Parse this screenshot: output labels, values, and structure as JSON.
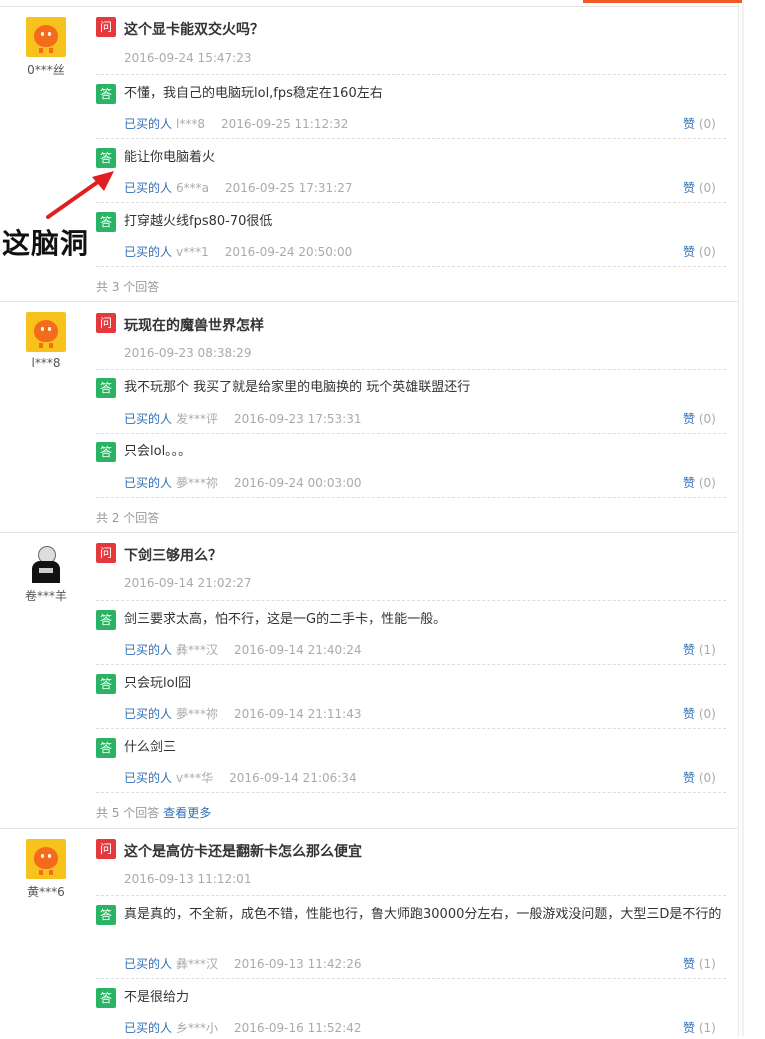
{
  "annotation": {
    "text": "这脑洞"
  },
  "questions": [
    {
      "asker": "0***丝",
      "avatar": "orange-mascot",
      "badge_q": "问",
      "title": "这个显卡能双交火吗？",
      "time": "2016-09-24 15:47:23",
      "answers": [
        {
          "badge": "答",
          "text": "不懂，我自己的电脑玩lol,fps稳定在160左右",
          "buyer": "已买的人",
          "user": "l***8",
          "time": "2016-09-25 11:12:32",
          "like_label": "赞",
          "like_count": "(0)"
        },
        {
          "badge": "答",
          "text": "能让你电脑着火",
          "buyer": "已买的人",
          "user": "6***a",
          "time": "2016-09-25 17:31:27",
          "like_label": "赞",
          "like_count": "(0)"
        },
        {
          "badge": "答",
          "text": "打穿越火线fps80-70很低",
          "buyer": "已买的人",
          "user": "v***1",
          "time": "2016-09-24 20:50:00",
          "like_label": "赞",
          "like_count": "(0)"
        }
      ],
      "count": "共 3 个回答"
    },
    {
      "asker": "l***8",
      "avatar": "orange-mascot",
      "badge_q": "问",
      "title": "玩现在的魔兽世界怎样",
      "time": "2016-09-23 08:38:29",
      "answers": [
        {
          "badge": "答",
          "text": "我不玩那个 我买了就是给家里的电脑换的 玩个英雄联盟还行",
          "buyer": "已买的人",
          "user": "发***评",
          "time": "2016-09-23 17:53:31",
          "like_label": "赞",
          "like_count": "(0)"
        },
        {
          "badge": "答",
          "text": "只会lol。。。",
          "buyer": "已买的人",
          "user": "夢***祢",
          "time": "2016-09-24 00:03:00",
          "like_label": "赞",
          "like_count": "(0)"
        }
      ],
      "count": "共 2 个回答"
    },
    {
      "asker": "卷***羊",
      "avatar": "photo",
      "badge_q": "问",
      "title": "下剑三够用么？",
      "time": "2016-09-14 21:02:27",
      "answers": [
        {
          "badge": "答",
          "text": "剑三要求太高，怕不行，这是一G的二手卡，性能一般。",
          "buyer": "已买的人",
          "user": "彝***汉",
          "time": "2016-09-14 21:40:24",
          "like_label": "赞",
          "like_count": "(1)"
        },
        {
          "badge": "答",
          "text": "只会玩lol囧",
          "buyer": "已买的人",
          "user": "夢***祢",
          "time": "2016-09-14 21:11:43",
          "like_label": "赞",
          "like_count": "(0)"
        },
        {
          "badge": "答",
          "text": "什么剑三",
          "buyer": "已买的人",
          "user": "v***华",
          "time": "2016-09-14 21:06:34",
          "like_label": "赞",
          "like_count": "(0)"
        }
      ],
      "count": "共 5 个回答",
      "more": "查看更多"
    },
    {
      "asker": "黄***6",
      "avatar": "orange-mascot",
      "badge_q": "问",
      "title": "这个是高仿卡还是翻新卡怎么那么便宜",
      "time": "2016-09-13 11:12:01",
      "answers": [
        {
          "badge": "答",
          "text": "真是真的，不全新，成色不错，性能也行，鲁大师跑30000分左右，一般游戏没问题，大型三D是不行的",
          "buyer": "已买的人",
          "user": "彝***汉",
          "time": "2016-09-13 11:42:26",
          "like_label": "赞",
          "like_count": "(1)"
        },
        {
          "badge": "答",
          "text": "不是很给力",
          "buyer": "已买的人",
          "user": "乡***小",
          "time": "2016-09-16 11:52:42",
          "like_label": "赞",
          "like_count": "(1)"
        }
      ]
    }
  ]
}
